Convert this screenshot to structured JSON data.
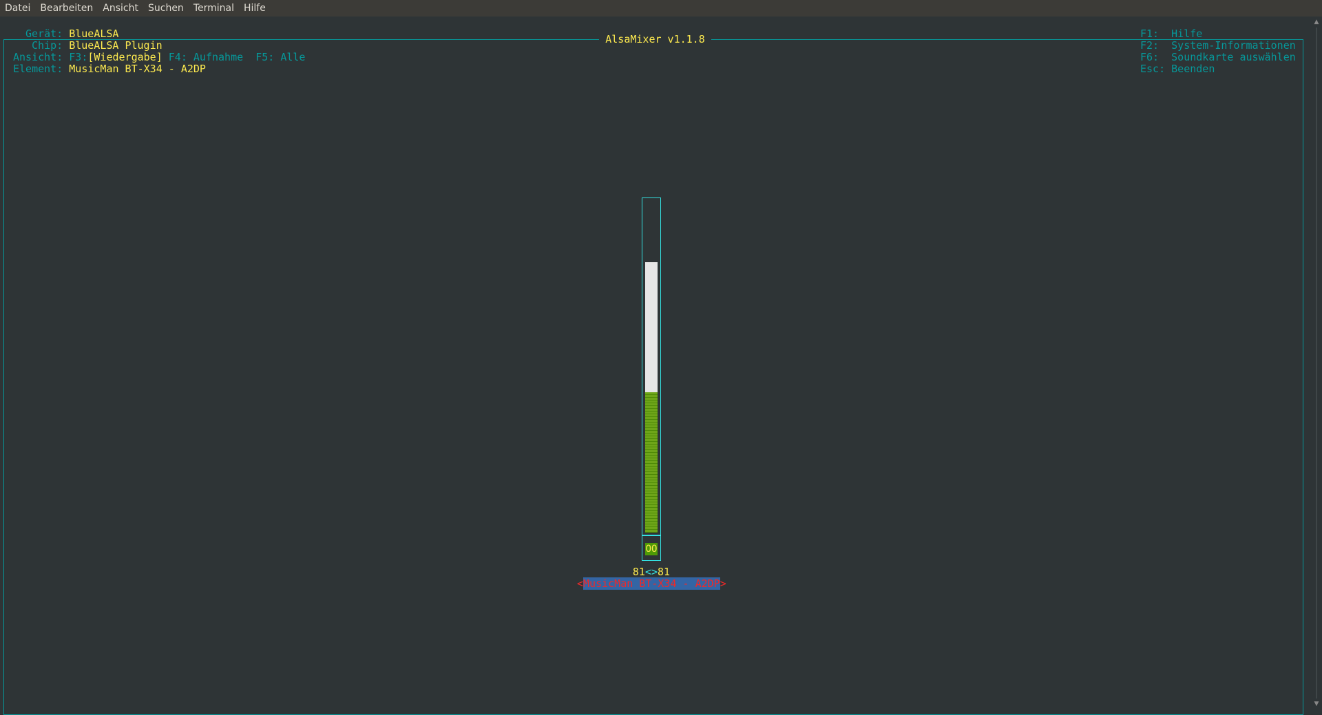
{
  "menu": {
    "items": [
      "Datei",
      "Bearbeiten",
      "Ansicht",
      "Suchen",
      "Terminal",
      "Hilfe"
    ]
  },
  "title": "AlsaMixer v1.1.8",
  "info": {
    "device_label": "Gerät:",
    "device_value": "BlueALSA",
    "chip_label": "Chip:",
    "chip_value": "BlueALSA Plugin",
    "view_label": "Ansicht:",
    "view_f3_key": "F3:",
    "view_f3_value": "[Wiedergabe]",
    "view_f4": "F4: Aufnahme",
    "view_f5": "F5: Alle",
    "element_label": "Element:",
    "element_value": "MusicMan BT-X34 - A2DP"
  },
  "help": {
    "f1_key": "F1:",
    "f1_text": "Hilfe",
    "f2_key": "F2:",
    "f2_text": "System-Informationen",
    "f6_key": "F6:",
    "f6_text": "Soundkarte auswählen",
    "esc_key": "Esc:",
    "esc_text": "Beenden"
  },
  "control": {
    "level": 0.52,
    "mute_value": "OO",
    "volume_left": "81",
    "volume_sep": "<>",
    "volume_right": "81",
    "name": "MusicMan BT-X34 - A2DP",
    "arrow_left": "<",
    "arrow_right": ">"
  },
  "colors": {
    "background": "#2e3436",
    "frame": "#06989a",
    "label": "#06989a",
    "value": "#fce94f",
    "fill": "#4e9a06",
    "selection": "#3465a4",
    "selection_text": "#ef2929"
  }
}
